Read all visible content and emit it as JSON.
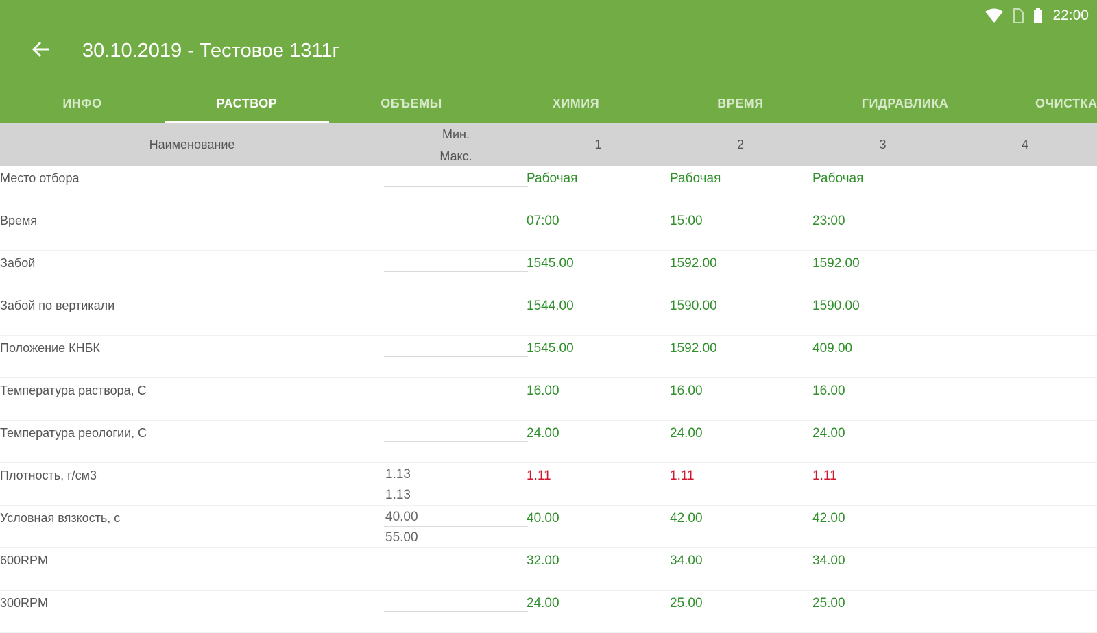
{
  "status": {
    "time": "22:00",
    "icons": [
      "wifi-icon",
      "no-sim-icon",
      "battery-icon"
    ]
  },
  "toolbar": {
    "title": "30.10.2019 - Тестовое 1311г",
    "back_icon": "arrow-left-icon"
  },
  "tabs": [
    {
      "label": "ИНФО",
      "active": false
    },
    {
      "label": "РАСТВОР",
      "active": true
    },
    {
      "label": "ОБЪЕМЫ",
      "active": false
    },
    {
      "label": "ХИМИЯ",
      "active": false
    },
    {
      "label": "ВРЕМЯ",
      "active": false
    },
    {
      "label": "ГИДРАВЛИКА",
      "active": false
    },
    {
      "label": "ОЧИСТКА",
      "active": false
    }
  ],
  "header": {
    "name": "Наименование",
    "min": "Мин.",
    "max": "Макс.",
    "cols": [
      "1",
      "2",
      "3",
      "4"
    ]
  },
  "rows": [
    {
      "name": "Место отбора",
      "min": "",
      "max": "",
      "values": [
        "Рабочая",
        "Рабочая",
        "Рабочая"
      ]
    },
    {
      "name": "Время",
      "min": "",
      "max": "",
      "values": [
        "07:00",
        "15:00",
        "23:00"
      ]
    },
    {
      "name": "Забой",
      "min": "",
      "max": "",
      "values": [
        "1545.00",
        "1592.00",
        "1592.00"
      ]
    },
    {
      "name": "Забой по вертикали",
      "min": "",
      "max": "",
      "values": [
        "1544.00",
        "1590.00",
        "1590.00"
      ]
    },
    {
      "name": "Положение КНБК",
      "min": "",
      "max": "",
      "values": [
        "1545.00",
        "1592.00",
        "409.00"
      ]
    },
    {
      "name": "Температура раствора, С",
      "min": "",
      "max": "",
      "values": [
        "16.00",
        "16.00",
        "16.00"
      ]
    },
    {
      "name": "Температура реологии, С",
      "min": "",
      "max": "",
      "values": [
        "24.00",
        "24.00",
        "24.00"
      ]
    },
    {
      "name": "Плотность, г/см3",
      "min": "1.13",
      "max": "1.13",
      "values": [
        "1.11",
        "1.11",
        "1.11"
      ],
      "out_of_range": true
    },
    {
      "name": "Условная вязкость, с",
      "min": "40.00",
      "max": "55.00",
      "values": [
        "40.00",
        "42.00",
        "42.00"
      ]
    },
    {
      "name": "600RPM",
      "min": "",
      "max": "",
      "values": [
        "32.00",
        "34.00",
        "34.00"
      ]
    },
    {
      "name": "300RPM",
      "min": "",
      "max": "",
      "values": [
        "24.00",
        "25.00",
        "25.00"
      ]
    }
  ],
  "colors": {
    "appbar": "#71ad44",
    "ok_value": "#2f8f2a",
    "bad_value": "#d0192f",
    "header_bg": "#d3d3d3"
  }
}
